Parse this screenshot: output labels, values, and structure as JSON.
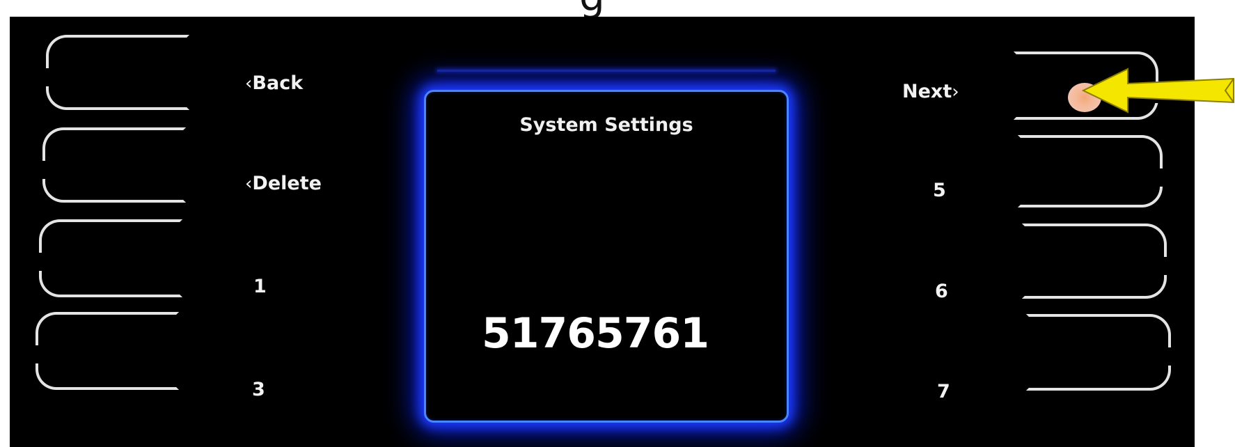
{
  "heading_fragment": "g",
  "left_keys": [
    {
      "label": "Back",
      "chevron": "‹"
    },
    {
      "label": "Delete",
      "chevron": "‹"
    },
    {
      "label": "1",
      "chevron": ""
    },
    {
      "label": "3",
      "chevron": ""
    }
  ],
  "right_keys": [
    {
      "label": "Next",
      "chevron": "›"
    },
    {
      "label": "5",
      "chevron": ""
    },
    {
      "label": "6",
      "chevron": ""
    },
    {
      "label": "7",
      "chevron": ""
    }
  ],
  "screen": {
    "title": "System Settings",
    "code": "51765761"
  },
  "annotation": {
    "arrow_color": "#f5e600",
    "dot_color": "#f2b08f",
    "arrow_icon": "yellow-arrow-pointer-icon"
  },
  "colors": {
    "panel": "#000000",
    "glow": "#1f3dff",
    "bezel": "#e4e4e4",
    "text": "#f2f2f2"
  }
}
